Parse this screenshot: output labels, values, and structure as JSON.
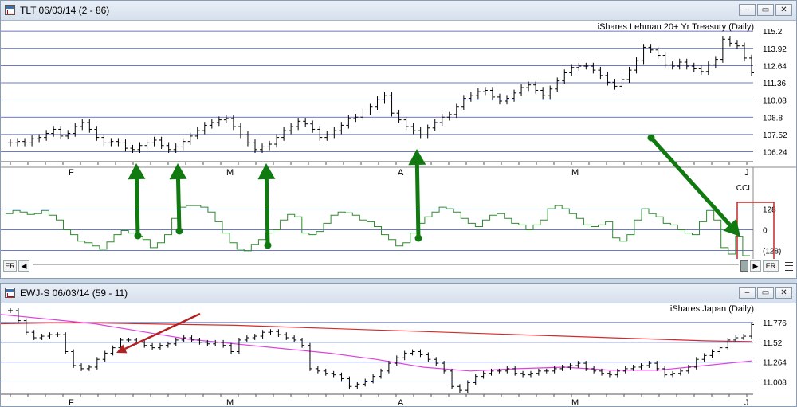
{
  "win1": {
    "title": "TLT 06/03/14 (2 - 86)",
    "chart_title": "iShares Lehman 20+ Yr Treasury (Daily)",
    "indicator_label": "CCI",
    "buttons": {
      "minimize": "–",
      "restore": "▭",
      "close": "✕"
    },
    "scroll": {
      "er_left": "ER",
      "er_right": "ER",
      "left_arrow": "◀",
      "right_arrow": "▶"
    }
  },
  "win2": {
    "title": "EWJ-S 06/03/14 (59 - 11)",
    "chart_title": "iShares Japan (Daily)",
    "buttons": {
      "minimize": "–",
      "restore": "▭",
      "close": "✕"
    }
  },
  "colors": {
    "price": "#000000",
    "cci": "#2e8b2e",
    "arrow_green": "#107a10",
    "arrow_red": "#b22222",
    "grid": "#3a4fa8",
    "ma_red": "#d62a2a",
    "ma_magenta": "#e040e0",
    "highlight_box": "#c0282a"
  },
  "chart_data": [
    {
      "type": "ohlc",
      "name": "TLT price",
      "title": "iShares Lehman 20+ Yr Treasury (Daily)",
      "yticks": [
        "115.2",
        "113.92",
        "112.64",
        "111.36",
        "110.08",
        "108.8",
        "107.52",
        "106.24"
      ],
      "ylim": [
        105.5,
        115.8
      ],
      "xticks": [
        "F",
        "M",
        "A",
        "M",
        "J"
      ],
      "values": [
        106.9,
        107.0,
        106.9,
        107.2,
        107.3,
        107.6,
        107.9,
        107.4,
        107.6,
        108.1,
        108.4,
        107.9,
        107.3,
        106.9,
        107.0,
        106.9,
        106.5,
        106.4,
        106.7,
        106.9,
        107.1,
        106.7,
        106.4,
        106.6,
        107.0,
        107.4,
        107.8,
        108.2,
        108.4,
        108.6,
        108.7,
        108.1,
        107.5,
        106.9,
        106.4,
        106.6,
        106.8,
        107.3,
        107.8,
        108.1,
        108.5,
        108.3,
        107.9,
        107.3,
        107.5,
        107.8,
        108.2,
        108.7,
        108.8,
        109.2,
        109.6,
        110.1,
        110.4,
        109.1,
        108.6,
        108.1,
        107.8,
        107.5,
        108.0,
        108.4,
        108.8,
        109.0,
        109.6,
        110.2,
        110.4,
        110.7,
        110.8,
        110.3,
        110.0,
        110.2,
        110.6,
        111.0,
        111.2,
        110.8,
        110.4,
        110.9,
        111.5,
        112.1,
        112.5,
        112.6,
        112.6,
        112.3,
        111.9,
        111.4,
        111.1,
        111.6,
        112.3,
        113.0,
        114.0,
        113.8,
        113.4,
        112.7,
        112.6,
        112.9,
        112.6,
        112.4,
        112.2,
        112.7,
        113.1,
        114.6,
        114.3,
        114.1,
        113.2,
        112.1
      ]
    },
    {
      "type": "line",
      "name": "CCI",
      "yticks": [
        "128",
        "0",
        "(128)"
      ],
      "ylim": [
        -160,
        175
      ],
      "values": [
        100,
        120,
        110,
        95,
        100,
        120,
        90,
        60,
        0,
        -30,
        -70,
        -80,
        -100,
        -120,
        -75,
        -30,
        -5,
        -20,
        -40,
        -60,
        -110,
        -80,
        -30,
        70,
        140,
        150,
        150,
        140,
        110,
        50,
        -20,
        -80,
        -120,
        -130,
        -90,
        -60,
        -20,
        0,
        60,
        95,
        80,
        -20,
        -30,
        -10,
        40,
        90,
        110,
        105,
        90,
        60,
        50,
        20,
        -30,
        -60,
        -100,
        -80,
        -20,
        40,
        80,
        110,
        140,
        130,
        110,
        70,
        40,
        20,
        60,
        90,
        100,
        70,
        40,
        30,
        0,
        30,
        60,
        130,
        150,
        130,
        100,
        70,
        30,
        20,
        30,
        50,
        -50,
        -70,
        -30,
        60,
        130,
        100,
        80,
        40,
        30,
        0,
        -20,
        -30,
        50,
        120,
        60,
        -110,
        -150,
        -40,
        -160
      ]
    },
    {
      "type": "ohlc",
      "name": "EWJ price",
      "title": "iShares Japan (Daily)",
      "yticks": [
        "11.776",
        "11.52",
        "11.264",
        "11.008"
      ],
      "ylim": [
        10.85,
        11.95
      ],
      "xticks": [
        "F",
        "M",
        "A",
        "M",
        "J"
      ],
      "values": [
        11.93,
        11.8,
        11.65,
        11.58,
        11.6,
        11.62,
        11.62,
        11.4,
        11.22,
        11.18,
        11.2,
        11.3,
        11.38,
        11.45,
        11.55,
        11.55,
        11.52,
        11.48,
        11.45,
        11.48,
        11.5,
        11.55,
        11.58,
        11.55,
        11.52,
        11.5,
        11.52,
        11.48,
        11.4,
        11.55,
        11.58,
        11.6,
        11.65,
        11.66,
        11.62,
        11.58,
        11.55,
        11.48,
        11.18,
        11.15,
        11.12,
        11.1,
        11.05,
        10.95,
        10.98,
        11.02,
        11.08,
        11.15,
        11.25,
        11.32,
        11.38,
        11.4,
        11.36,
        11.3,
        11.25,
        11.15,
        10.95,
        10.9,
        11.0,
        11.08,
        11.12,
        11.15,
        11.15,
        11.18,
        11.12,
        11.1,
        11.12,
        11.15,
        11.15,
        11.18,
        11.2,
        11.22,
        11.25,
        11.18,
        11.15,
        11.12,
        11.1,
        11.15,
        11.18,
        11.2,
        11.22,
        11.25,
        11.18,
        11.1,
        11.12,
        11.15,
        11.2,
        11.3,
        11.35,
        11.4,
        11.45,
        11.55,
        11.58,
        11.6,
        11.75
      ]
    },
    {
      "type": "line",
      "name": "EWJ moving averages",
      "values_red": [
        11.76,
        11.77,
        11.77,
        11.76,
        11.75,
        11.74,
        11.72,
        11.7,
        11.68,
        11.66,
        11.64,
        11.62,
        11.6,
        11.58,
        11.56,
        11.54,
        11.53
      ],
      "values_magenta": [
        11.88,
        11.82,
        11.76,
        11.66,
        11.56,
        11.5,
        11.44,
        11.38,
        11.3,
        11.2,
        11.15,
        11.18,
        11.2,
        11.16,
        11.16,
        11.22,
        11.28
      ]
    }
  ]
}
